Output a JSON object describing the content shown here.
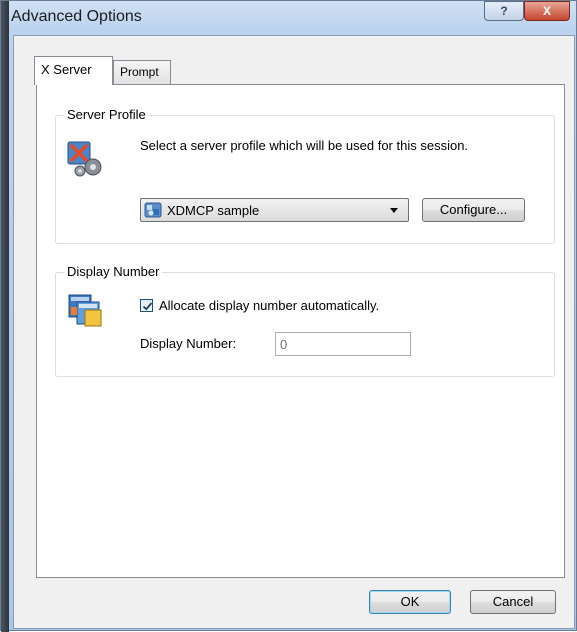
{
  "window": {
    "title": "Advanced Options",
    "help_label": "?",
    "close_label": "X"
  },
  "tabs": [
    {
      "label": "X Server",
      "active": true
    },
    {
      "label": "Prompt",
      "active": false
    }
  ],
  "server_profile": {
    "group_title": "Server Profile",
    "description": "Select a server profile which will be used for this session.",
    "selected_profile": "XDMCP sample",
    "configure_label": "Configure..."
  },
  "display_number": {
    "group_title": "Display Number",
    "allocate_label": "Allocate display number automatically.",
    "allocate_checked": true,
    "field_label": "Display Number:",
    "field_value": "0"
  },
  "buttons": {
    "ok_label": "OK",
    "cancel_label": "Cancel"
  },
  "icons": {
    "server_profile": "server-gear-icon",
    "display_number": "windows-stack-icon",
    "profile_item": "xdmcp-profile-icon"
  }
}
